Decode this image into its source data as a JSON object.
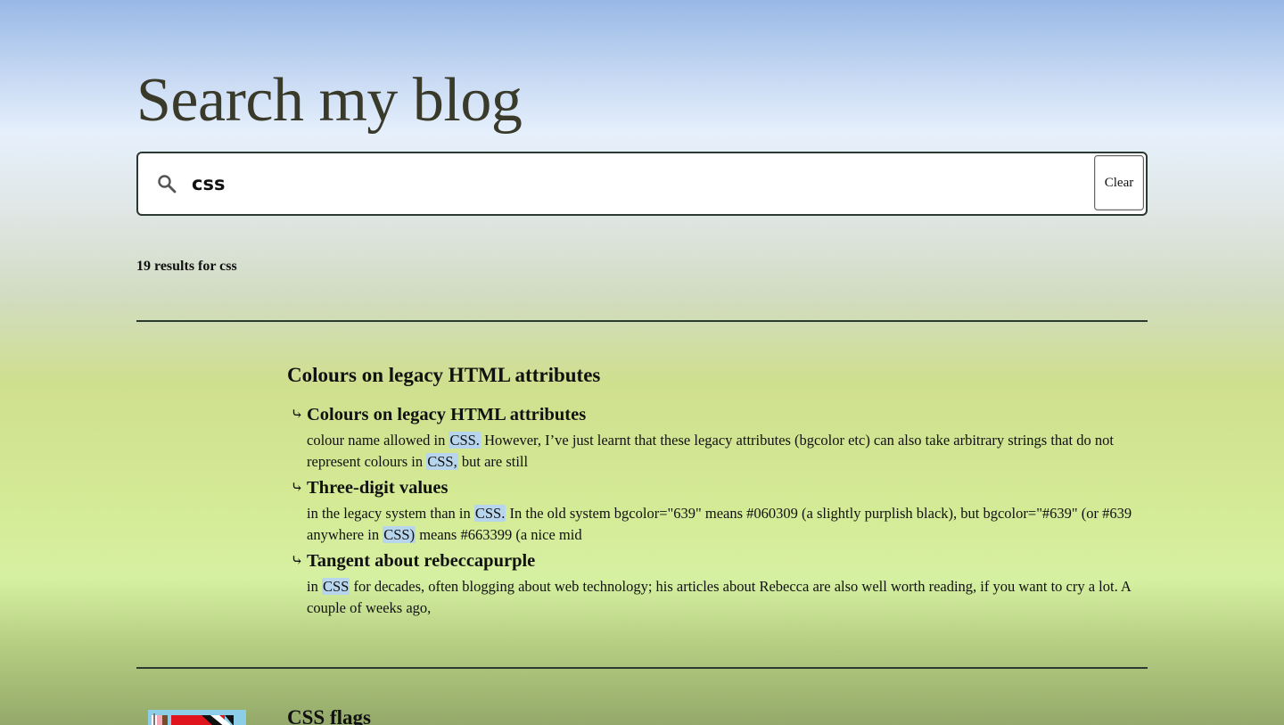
{
  "page": {
    "title": "Search my blog"
  },
  "search": {
    "query": "css",
    "clear_label": "Clear",
    "icon": "search-icon"
  },
  "results": {
    "count_text": "19 results for css",
    "items": [
      {
        "title": "Colours on legacy HTML attributes",
        "sections": [
          {
            "heading": "Colours on legacy HTML attributes",
            "snippet": [
              {
                "t": "colour name allowed in ",
                "m": false
              },
              {
                "t": "CSS.",
                "m": true
              },
              {
                "t": " However, I’ve just learnt that these legacy attributes (bgcolor etc) can also take arbitrary strings that do not represent colours in ",
                "m": false
              },
              {
                "t": "CSS,",
                "m": true
              },
              {
                "t": " but are still",
                "m": false
              }
            ]
          },
          {
            "heading": "Three-digit values",
            "snippet": [
              {
                "t": "in the legacy system than in ",
                "m": false
              },
              {
                "t": "CSS.",
                "m": true
              },
              {
                "t": " In the old system bgcolor=\"639\" means #060309 (a slightly purplish black), but bgcolor=\"#639\" (or #639 anywhere in ",
                "m": false
              },
              {
                "t": "CSS)",
                "m": true
              },
              {
                "t": " means #663399 (a nice mid",
                "m": false
              }
            ]
          },
          {
            "heading": "Tangent about rebeccapurple",
            "snippet": [
              {
                "t": "in ",
                "m": false
              },
              {
                "t": "CSS",
                "m": true
              },
              {
                "t": " for decades, often blogging about web technology; his articles about Rebecca are also well worth reading, if you want to cry a lot. A couple of weeks ago,",
                "m": false
              }
            ]
          }
        ]
      },
      {
        "title": "CSS flags",
        "sections": []
      }
    ]
  },
  "colors": {
    "highlight": "#b7d5ec",
    "border": "#2a3a30",
    "title_text": "#3a3a2a"
  }
}
